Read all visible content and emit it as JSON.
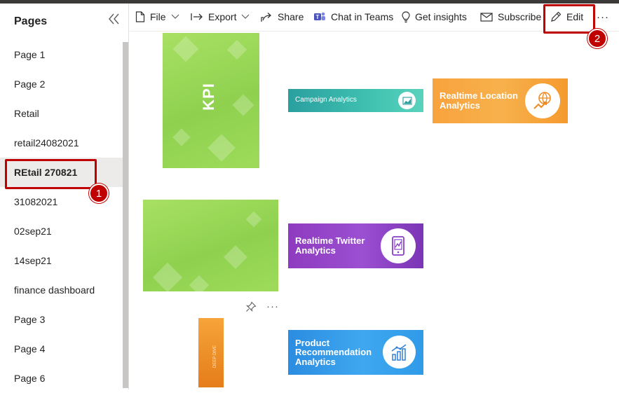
{
  "sidebar": {
    "title": "Pages",
    "pages": [
      {
        "label": "Page 1"
      },
      {
        "label": "Page 2"
      },
      {
        "label": "Retail"
      },
      {
        "label": "retail24082021"
      },
      {
        "label": "REtail 270821",
        "active": true
      },
      {
        "label": "31082021"
      },
      {
        "label": "02sep21"
      },
      {
        "label": "14sep21"
      },
      {
        "label": "finance dashboard"
      },
      {
        "label": "Page 3"
      },
      {
        "label": "Page 4"
      },
      {
        "label": "Page 6"
      }
    ]
  },
  "toolbar": {
    "file_label": "File",
    "export_label": "Export",
    "share_label": "Share",
    "chat_label": "Chat in Teams",
    "insights_label": "Get insights",
    "subscribe_label": "Subscribe",
    "edit_label": "Edit",
    "more_label": "···"
  },
  "annotations": {
    "step1": "1",
    "step2": "2"
  },
  "tiles": {
    "kpi_label": "KPI",
    "campaign_label": "Campaign Analytics",
    "location_label": "Realtime Location Analytics",
    "twitter_label": "Realtime Twitter Analytics",
    "product_label": "Product Recommendation Analytics",
    "orange_strip_text": "DEEP DIVE",
    "tile_more": "···"
  },
  "colors": {
    "accent_red": "#c00000",
    "active_page_bg": "#edebe9",
    "green_tile": "#9edb5a",
    "campaign": "#2fb5a6",
    "location": "#f7a035",
    "twitter": "#8a3fc7",
    "product": "#2f9be8"
  }
}
